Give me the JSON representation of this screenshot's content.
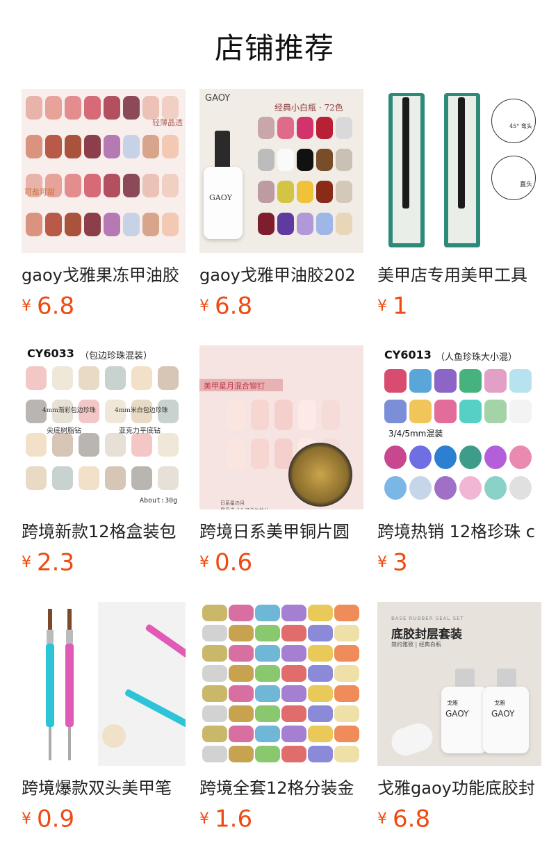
{
  "page": {
    "title": "店铺推荐"
  },
  "currency": "¥",
  "products": [
    {
      "name": "gaoy戈雅果冻甲油胶",
      "price": "6.8",
      "image": {
        "badge_top": "轻薄晶透",
        "badge_bottom": "可盐可甜"
      }
    },
    {
      "name": "gaoy戈雅甲油胶202",
      "price": "6.8",
      "image": {
        "brand": "GAOY",
        "heading": "经典小白瓶 · 72色",
        "bottle_brand": "GAOY"
      }
    },
    {
      "name": "美甲店专用美甲工具",
      "price": "1",
      "image": {
        "label_bend": "45° 弯头",
        "label_straight": "直头"
      }
    },
    {
      "name": "跨境新款12格盒装包",
      "price": "2.3",
      "image": {
        "code": "CY6033",
        "subtitle": "（包边珍珠混装）",
        "label1": "4mm渐彩包边珍珠",
        "label2": "4mm米白包边珍珠",
        "label3": "尖底树脂钻",
        "label4": "亚克力平底钻",
        "weight": "About:30g"
      }
    },
    {
      "name": "跨境日系美甲铜片圆",
      "price": "0.6",
      "image": {
        "banner": "美甲星月混合铆钉",
        "caption": "日系星の月\n星月ネイルアクセサリー"
      }
    },
    {
      "name": "跨境热销 12格珍珠 c",
      "price": "3",
      "image": {
        "code": "CY6013",
        "subtitle": "（人鱼珍珠大小混）",
        "sizes": "3/4/5mm混装"
      }
    },
    {
      "name": "跨境爆款双头美甲笔",
      "price": "0.9",
      "image": {}
    },
    {
      "name": "跨境全套12格分装金",
      "price": "1.6",
      "image": {}
    },
    {
      "name": "戈雅gaoy功能底胶封",
      "price": "6.8",
      "image": {
        "en": "BASE RUBBER SEAL SET",
        "heading": "底胶封层套装",
        "sub": "简约雅致 | 经典白瓶",
        "brand": "GAOY",
        "bottle_cn": "戈雅"
      }
    }
  ],
  "colors": {
    "price": "#ee4b12",
    "text": "#222222"
  }
}
